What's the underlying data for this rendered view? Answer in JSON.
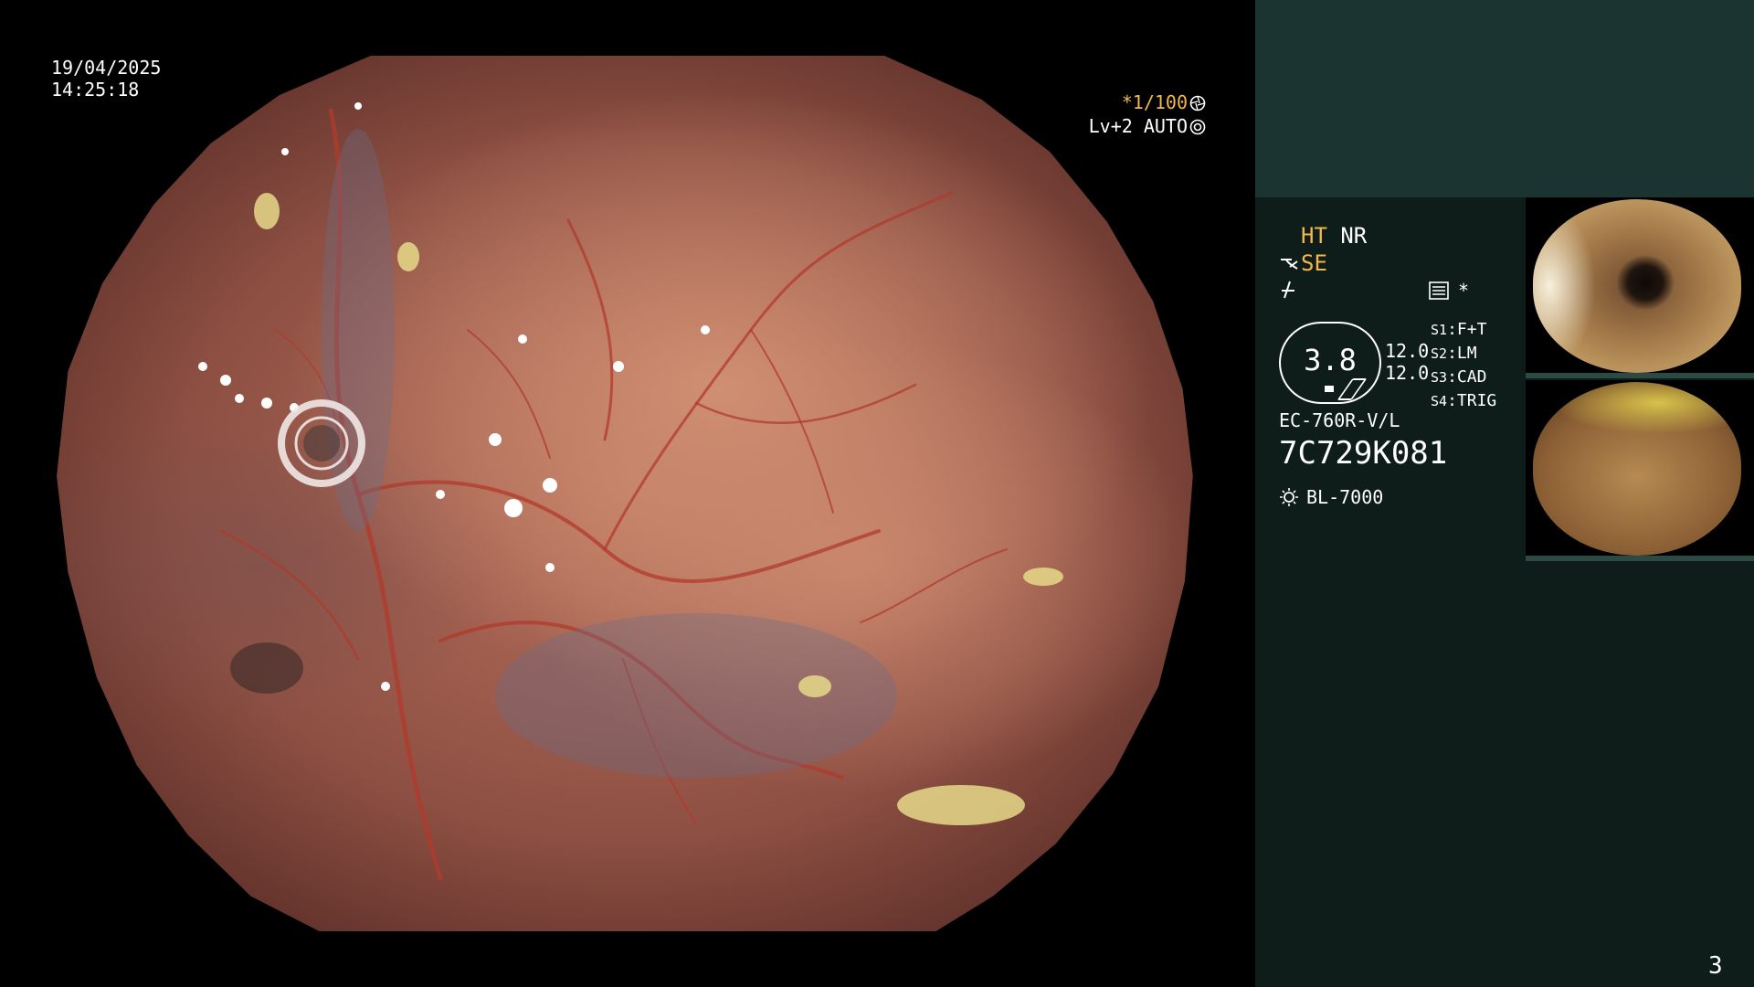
{
  "osd": {
    "date": "19/04/2025",
    "time": "14:25:18",
    "shutter": "*1/100",
    "shutter_icon": "aperture-icon",
    "level": "Lv+2 AUTO",
    "level_icon": "auto-iris-icon"
  },
  "panel": {
    "ht": "HT",
    "nr": "NR",
    "se": "SE",
    "se_icon": "structure-enhance-icon",
    "zoom_icon": "zoom-icon",
    "menu_icon": "menu-icon",
    "menu_star": "*",
    "gauge_value": "3.8",
    "gain_1": "12.0",
    "gain_2": "12.0",
    "switches": [
      {
        "key": "S1",
        "value": "F+T"
      },
      {
        "key": "S2",
        "value": "LM"
      },
      {
        "key": "S3",
        "value": "CAD"
      },
      {
        "key": "S4",
        "value": "TRIG"
      }
    ],
    "scope_model": "EC-760R-V/L",
    "scope_serial": "7C729K081",
    "light_source": "BL-7000",
    "light_icon": "sun-icon"
  },
  "page_number": "3",
  "colors": {
    "amber": "#f2b84a",
    "panel_top": "#1b3431",
    "panel_main": "#0e1c1a"
  }
}
